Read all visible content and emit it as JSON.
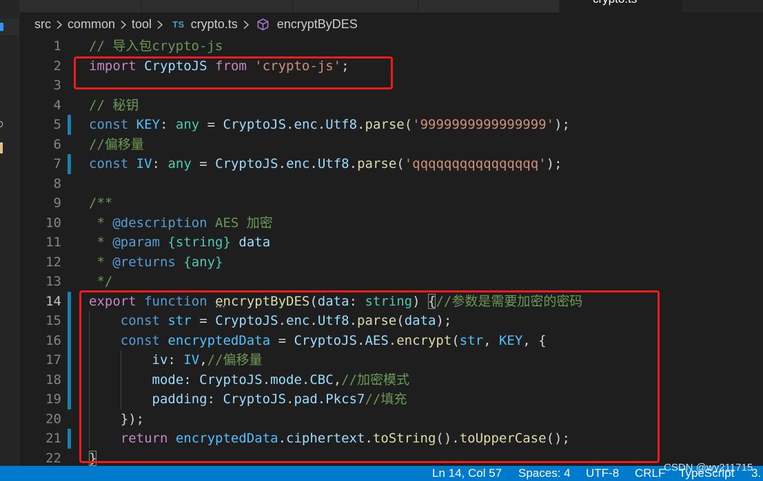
{
  "tabs": {
    "active_label": "crypto.ts",
    "more_actions_icon": "more-actions-icon"
  },
  "breadcrumb": {
    "items": [
      "src",
      "common",
      "tool"
    ],
    "file_icon_label": "TS",
    "file": "crypto.ts",
    "symbol_icon": "method-cube-icon",
    "symbol": "encryptByDES"
  },
  "editor": {
    "lines": [
      {
        "number": 1,
        "tokens": [
          {
            "text": "// 导入包crypto-js",
            "color": "#6a9955"
          }
        ]
      },
      {
        "number": 2,
        "tokens": [
          {
            "text": "import",
            "color": "#c586c0"
          },
          {
            "text": " ",
            "color": "#d4d4d4"
          },
          {
            "text": "CryptoJS",
            "color": "#9cdcfe"
          },
          {
            "text": " ",
            "color": "#d4d4d4"
          },
          {
            "text": "from",
            "color": "#c586c0"
          },
          {
            "text": " ",
            "color": "#d4d4d4"
          },
          {
            "text": "'crypto-js'",
            "color": "#ce9178"
          },
          {
            "text": ";",
            "color": "#d4d4d4"
          }
        ]
      },
      {
        "number": 3,
        "tokens": []
      },
      {
        "number": 4,
        "tokens": [
          {
            "text": "// 秘钥",
            "color": "#6a9955"
          }
        ]
      },
      {
        "number": 5,
        "modified": true,
        "tokens": [
          {
            "text": "const",
            "color": "#569cd6"
          },
          {
            "text": " ",
            "color": "#d4d4d4"
          },
          {
            "text": "KEY",
            "color": "#4fc1ff"
          },
          {
            "text": ": ",
            "color": "#d4d4d4"
          },
          {
            "text": "any",
            "color": "#4ec9b0"
          },
          {
            "text": " = ",
            "color": "#d4d4d4"
          },
          {
            "text": "CryptoJS",
            "color": "#9cdcfe"
          },
          {
            "text": ".",
            "color": "#d4d4d4"
          },
          {
            "text": "enc",
            "color": "#9cdcfe"
          },
          {
            "text": ".",
            "color": "#d4d4d4"
          },
          {
            "text": "Utf8",
            "color": "#9cdcfe"
          },
          {
            "text": ".",
            "color": "#d4d4d4"
          },
          {
            "text": "parse",
            "color": "#dcdcaa"
          },
          {
            "text": "(",
            "color": "#d4d4d4"
          },
          {
            "text": "'9999999999999999'",
            "color": "#ce9178"
          },
          {
            "text": ");",
            "color": "#d4d4d4"
          }
        ]
      },
      {
        "number": 6,
        "tokens": [
          {
            "text": "//偏移量",
            "color": "#6a9955"
          }
        ]
      },
      {
        "number": 7,
        "modified": true,
        "tokens": [
          {
            "text": "const",
            "color": "#569cd6"
          },
          {
            "text": " ",
            "color": "#d4d4d4"
          },
          {
            "text": "IV",
            "color": "#4fc1ff"
          },
          {
            "text": ": ",
            "color": "#d4d4d4"
          },
          {
            "text": "any",
            "color": "#4ec9b0"
          },
          {
            "text": " = ",
            "color": "#d4d4d4"
          },
          {
            "text": "CryptoJS",
            "color": "#9cdcfe"
          },
          {
            "text": ".",
            "color": "#d4d4d4"
          },
          {
            "text": "enc",
            "color": "#9cdcfe"
          },
          {
            "text": ".",
            "color": "#d4d4d4"
          },
          {
            "text": "Utf8",
            "color": "#9cdcfe"
          },
          {
            "text": ".",
            "color": "#d4d4d4"
          },
          {
            "text": "parse",
            "color": "#dcdcaa"
          },
          {
            "text": "(",
            "color": "#d4d4d4"
          },
          {
            "text": "'qqqqqqqqqqqqqqqq'",
            "color": "#ce9178"
          },
          {
            "text": ");",
            "color": "#d4d4d4"
          }
        ]
      },
      {
        "number": 8,
        "tokens": []
      },
      {
        "number": 9,
        "tokens": [
          {
            "text": "/**",
            "color": "#6a9955"
          }
        ]
      },
      {
        "number": 10,
        "tokens": [
          {
            "text": " * ",
            "color": "#6a9955"
          },
          {
            "text": "@description",
            "color": "#569cd6"
          },
          {
            "text": " AES 加密",
            "color": "#6a9955"
          }
        ]
      },
      {
        "number": 11,
        "tokens": [
          {
            "text": " * ",
            "color": "#6a9955"
          },
          {
            "text": "@param",
            "color": "#569cd6"
          },
          {
            "text": " ",
            "color": "#6a9955"
          },
          {
            "text": "{string}",
            "color": "#4ec9b0"
          },
          {
            "text": " ",
            "color": "#6a9955"
          },
          {
            "text": "data",
            "color": "#9cdcfe"
          }
        ]
      },
      {
        "number": 12,
        "tokens": [
          {
            "text": " * ",
            "color": "#6a9955"
          },
          {
            "text": "@returns",
            "color": "#569cd6"
          },
          {
            "text": " ",
            "color": "#6a9955"
          },
          {
            "text": "{any}",
            "color": "#4ec9b0"
          }
        ]
      },
      {
        "number": 13,
        "tokens": [
          {
            "text": " */",
            "color": "#6a9955"
          }
        ]
      },
      {
        "number": 14,
        "active": true,
        "modified": true,
        "tokens": [
          {
            "text": "export",
            "color": "#c586c0"
          },
          {
            "text": " ",
            "color": "#d4d4d4"
          },
          {
            "text": "function",
            "color": "#569cd6"
          },
          {
            "text": " ",
            "color": "#d4d4d4"
          },
          {
            "text": "encryptByDES",
            "color": "#dcdcaa",
            "hint": true
          },
          {
            "text": "(",
            "color": "#d4d4d4"
          },
          {
            "text": "data",
            "color": "#9cdcfe"
          },
          {
            "text": ": ",
            "color": "#d4d4d4"
          },
          {
            "text": "string",
            "color": "#4ec9b0"
          },
          {
            "text": ") ",
            "color": "#d4d4d4"
          },
          {
            "text": "{",
            "color": "#d4d4d4",
            "bracket_match": true
          },
          {
            "text": "//参数是需要加密的密码",
            "color": "#6a9955"
          }
        ]
      },
      {
        "number": 15,
        "modified": true,
        "tokens": [
          {
            "text": "    ",
            "color": "#d4d4d4"
          },
          {
            "text": "const",
            "color": "#569cd6"
          },
          {
            "text": " ",
            "color": "#d4d4d4"
          },
          {
            "text": "str",
            "color": "#4fc1ff"
          },
          {
            "text": " = ",
            "color": "#d4d4d4"
          },
          {
            "text": "CryptoJS",
            "color": "#9cdcfe"
          },
          {
            "text": ".",
            "color": "#d4d4d4"
          },
          {
            "text": "enc",
            "color": "#9cdcfe"
          },
          {
            "text": ".",
            "color": "#d4d4d4"
          },
          {
            "text": "Utf8",
            "color": "#9cdcfe"
          },
          {
            "text": ".",
            "color": "#d4d4d4"
          },
          {
            "text": "parse",
            "color": "#dcdcaa"
          },
          {
            "text": "(",
            "color": "#d4d4d4"
          },
          {
            "text": "data",
            "color": "#9cdcfe"
          },
          {
            "text": ");",
            "color": "#d4d4d4"
          }
        ]
      },
      {
        "number": 16,
        "modified": true,
        "tokens": [
          {
            "text": "    ",
            "color": "#d4d4d4"
          },
          {
            "text": "const",
            "color": "#569cd6"
          },
          {
            "text": " ",
            "color": "#d4d4d4"
          },
          {
            "text": "encryptedData",
            "color": "#4fc1ff"
          },
          {
            "text": " = ",
            "color": "#d4d4d4"
          },
          {
            "text": "CryptoJS",
            "color": "#9cdcfe"
          },
          {
            "text": ".",
            "color": "#d4d4d4"
          },
          {
            "text": "AES",
            "color": "#9cdcfe"
          },
          {
            "text": ".",
            "color": "#d4d4d4"
          },
          {
            "text": "encrypt",
            "color": "#dcdcaa"
          },
          {
            "text": "(",
            "color": "#d4d4d4"
          },
          {
            "text": "str",
            "color": "#4fc1ff"
          },
          {
            "text": ", ",
            "color": "#d4d4d4"
          },
          {
            "text": "KEY",
            "color": "#4fc1ff"
          },
          {
            "text": ", {",
            "color": "#d4d4d4"
          }
        ]
      },
      {
        "number": 17,
        "modified": true,
        "tokens": [
          {
            "text": "        ",
            "color": "#d4d4d4"
          },
          {
            "text": "iv",
            "color": "#9cdcfe"
          },
          {
            "text": ": ",
            "color": "#d4d4d4"
          },
          {
            "text": "IV",
            "color": "#4fc1ff"
          },
          {
            "text": ",",
            "color": "#d4d4d4"
          },
          {
            "text": "//偏移量",
            "color": "#6a9955"
          }
        ]
      },
      {
        "number": 18,
        "modified": true,
        "tokens": [
          {
            "text": "        ",
            "color": "#d4d4d4"
          },
          {
            "text": "mode",
            "color": "#9cdcfe"
          },
          {
            "text": ": ",
            "color": "#d4d4d4"
          },
          {
            "text": "CryptoJS",
            "color": "#9cdcfe"
          },
          {
            "text": ".",
            "color": "#d4d4d4"
          },
          {
            "text": "mode",
            "color": "#9cdcfe"
          },
          {
            "text": ".",
            "color": "#d4d4d4"
          },
          {
            "text": "CBC",
            "color": "#9cdcfe"
          },
          {
            "text": ",",
            "color": "#d4d4d4"
          },
          {
            "text": "//加密模式",
            "color": "#6a9955"
          }
        ]
      },
      {
        "number": 19,
        "modified": true,
        "tokens": [
          {
            "text": "        ",
            "color": "#d4d4d4"
          },
          {
            "text": "padding",
            "color": "#9cdcfe"
          },
          {
            "text": ": ",
            "color": "#d4d4d4"
          },
          {
            "text": "CryptoJS",
            "color": "#9cdcfe"
          },
          {
            "text": ".",
            "color": "#d4d4d4"
          },
          {
            "text": "pad",
            "color": "#9cdcfe"
          },
          {
            "text": ".",
            "color": "#d4d4d4"
          },
          {
            "text": "Pkcs7",
            "color": "#9cdcfe"
          },
          {
            "text": "//填充",
            "color": "#6a9955"
          }
        ]
      },
      {
        "number": 20,
        "tokens": [
          {
            "text": "    ",
            "color": "#d4d4d4"
          },
          {
            "text": "});",
            "color": "#d4d4d4"
          }
        ]
      },
      {
        "number": 21,
        "modified": true,
        "tokens": [
          {
            "text": "    ",
            "color": "#d4d4d4"
          },
          {
            "text": "return",
            "color": "#c586c0"
          },
          {
            "text": " ",
            "color": "#d4d4d4"
          },
          {
            "text": "encryptedData",
            "color": "#4fc1ff"
          },
          {
            "text": ".",
            "color": "#d4d4d4"
          },
          {
            "text": "ciphertext",
            "color": "#9cdcfe"
          },
          {
            "text": ".",
            "color": "#d4d4d4"
          },
          {
            "text": "toString",
            "color": "#dcdcaa"
          },
          {
            "text": "().",
            "color": "#d4d4d4"
          },
          {
            "text": "toUpperCase",
            "color": "#dcdcaa"
          },
          {
            "text": "();",
            "color": "#d4d4d4"
          }
        ]
      },
      {
        "number": 22,
        "tokens": [
          {
            "text": "}",
            "color": "#d4d4d4",
            "bracket_match": true
          }
        ]
      }
    ]
  },
  "status_bar": {
    "cursor_position": "Ln 14, Col 57",
    "indentation": "Spaces: 4",
    "encoding": "UTF-8",
    "line_ending": "CRLF",
    "language_mode": "TypeScript",
    "version": "3."
  },
  "watermark": "CSDN @wy211715",
  "colors": {
    "status_bar": "#007acc",
    "annotation_box": "#ee1c1c",
    "git_modified": "#1b81a8",
    "editor_background": "#1e1e1e"
  }
}
